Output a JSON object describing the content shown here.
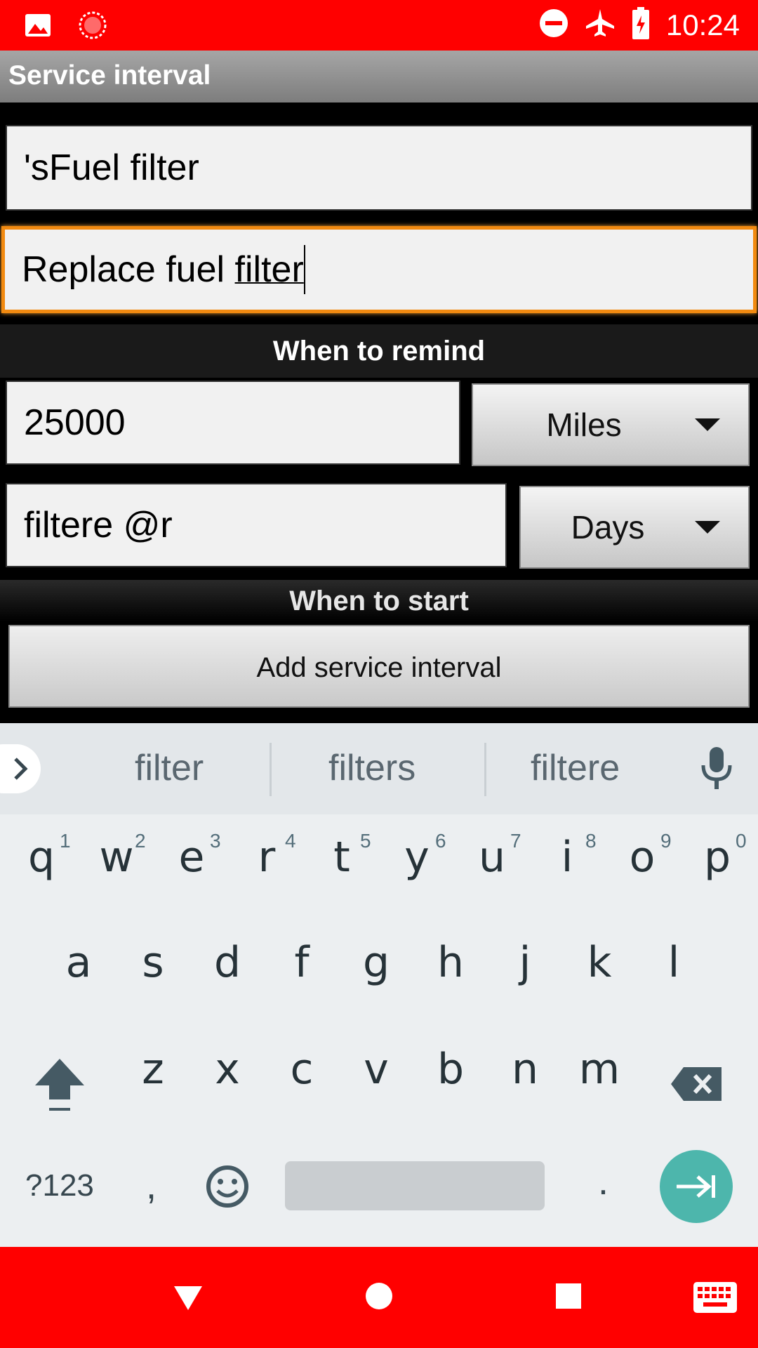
{
  "status_bar": {
    "time": "10:24",
    "icons": [
      "image-icon",
      "sync-icon",
      "do-not-disturb-icon",
      "airplane-mode-icon",
      "battery-charging-icon"
    ]
  },
  "app_bar": {
    "title": "Service interval"
  },
  "form": {
    "name_value": "'sFuel filter",
    "description_value_prefix": "Replace fuel ",
    "description_value_composing": "filter",
    "section_remind": "When to remind",
    "distance_value": "25000",
    "distance_unit": "Miles",
    "time_value": "filtere @r",
    "time_unit": "Days",
    "section_start": "When to start",
    "add_button": "Add service interval"
  },
  "keyboard": {
    "suggestions": [
      "filter",
      "filters",
      "filtere"
    ],
    "row1": [
      "q",
      "w",
      "e",
      "r",
      "t",
      "y",
      "u",
      "i",
      "o",
      "p"
    ],
    "row1_hints": [
      "1",
      "2",
      "3",
      "4",
      "5",
      "6",
      "7",
      "8",
      "9",
      "0"
    ],
    "row2": [
      "a",
      "s",
      "d",
      "f",
      "g",
      "h",
      "j",
      "k",
      "l"
    ],
    "row3": [
      "z",
      "x",
      "c",
      "v",
      "b",
      "n",
      "m"
    ],
    "symbols_key": "?123",
    "comma_key": ",",
    "period_key": "."
  },
  "colors": {
    "status_bar": "#ff0000",
    "focus_border": "#f28a10",
    "enter_key": "#4db6ac"
  }
}
